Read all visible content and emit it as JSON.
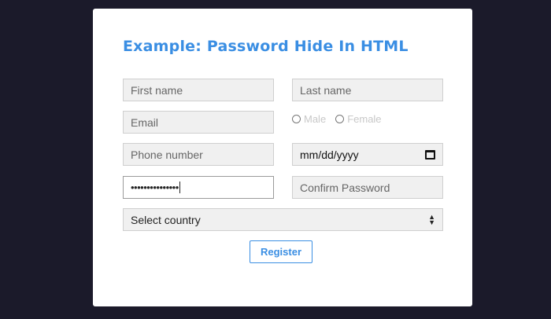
{
  "form": {
    "title": "Example: Password Hide In HTML",
    "first_name": {
      "placeholder": "First name"
    },
    "last_name": {
      "placeholder": "Last name"
    },
    "email": {
      "placeholder": "Email"
    },
    "gender": {
      "options": [
        "Male",
        "Female"
      ]
    },
    "phone": {
      "placeholder": "Phone number"
    },
    "date": {
      "value": "mm/dd/yyyy"
    },
    "password": {
      "value": "•••••••••••••••"
    },
    "confirm_password": {
      "placeholder": "Confirm Password"
    },
    "country": {
      "selected": "Select country"
    },
    "register_label": "Register"
  },
  "colors": {
    "background": "#1b1a2a",
    "accent": "#3a8ee3",
    "field_bg": "#f0f0f0"
  }
}
